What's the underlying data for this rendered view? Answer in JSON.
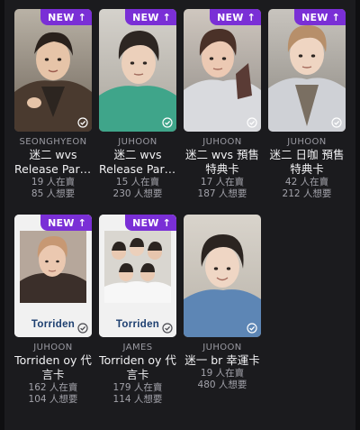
{
  "badge": {
    "label": "NEW",
    "arrow": "↑"
  },
  "cards": [
    {
      "artist": "SEONGHYEON",
      "title_lines": [
        "迷二 wvs",
        "Release Part..."
      ],
      "sellers": "19 人在賣",
      "wanters": "85 人想要",
      "is_new": true
    },
    {
      "artist": "JUHOON",
      "title_lines": [
        "迷二 wvs",
        "Release Part..."
      ],
      "sellers": "15 人在賣",
      "wanters": "230 人想要",
      "is_new": true
    },
    {
      "artist": "JUHOON",
      "title_lines": [
        "迷二 wvs 預售",
        "特典卡"
      ],
      "sellers": "17 人在賣",
      "wanters": "187 人想要",
      "is_new": true
    },
    {
      "artist": "JUHOON",
      "title_lines": [
        "迷二 日咖 預售",
        "特典卡"
      ],
      "sellers": "42 人在賣",
      "wanters": "212 人想要",
      "is_new": true
    },
    {
      "artist": "JUHOON",
      "title_lines": [
        "Torriden oy 代",
        "言卡"
      ],
      "sellers": "162 人在賣",
      "wanters": "104 人想要",
      "is_new": true,
      "card_text": "Torriden"
    },
    {
      "artist": "JAMES",
      "title_lines": [
        "Torriden oy 代",
        "言卡"
      ],
      "sellers": "179 人在賣",
      "wanters": "114 人想要",
      "is_new": true,
      "card_text": "Torriden"
    },
    {
      "artist": "JUHOON",
      "title_lines": [
        "迷一 br 幸運卡"
      ],
      "sellers": "19 人在賣",
      "wanters": "480 人想要",
      "is_new": false
    }
  ],
  "colors": {
    "background": "#1b1b1e",
    "badge": "#7a2fd6",
    "muted_text": "#a3a3ab"
  }
}
